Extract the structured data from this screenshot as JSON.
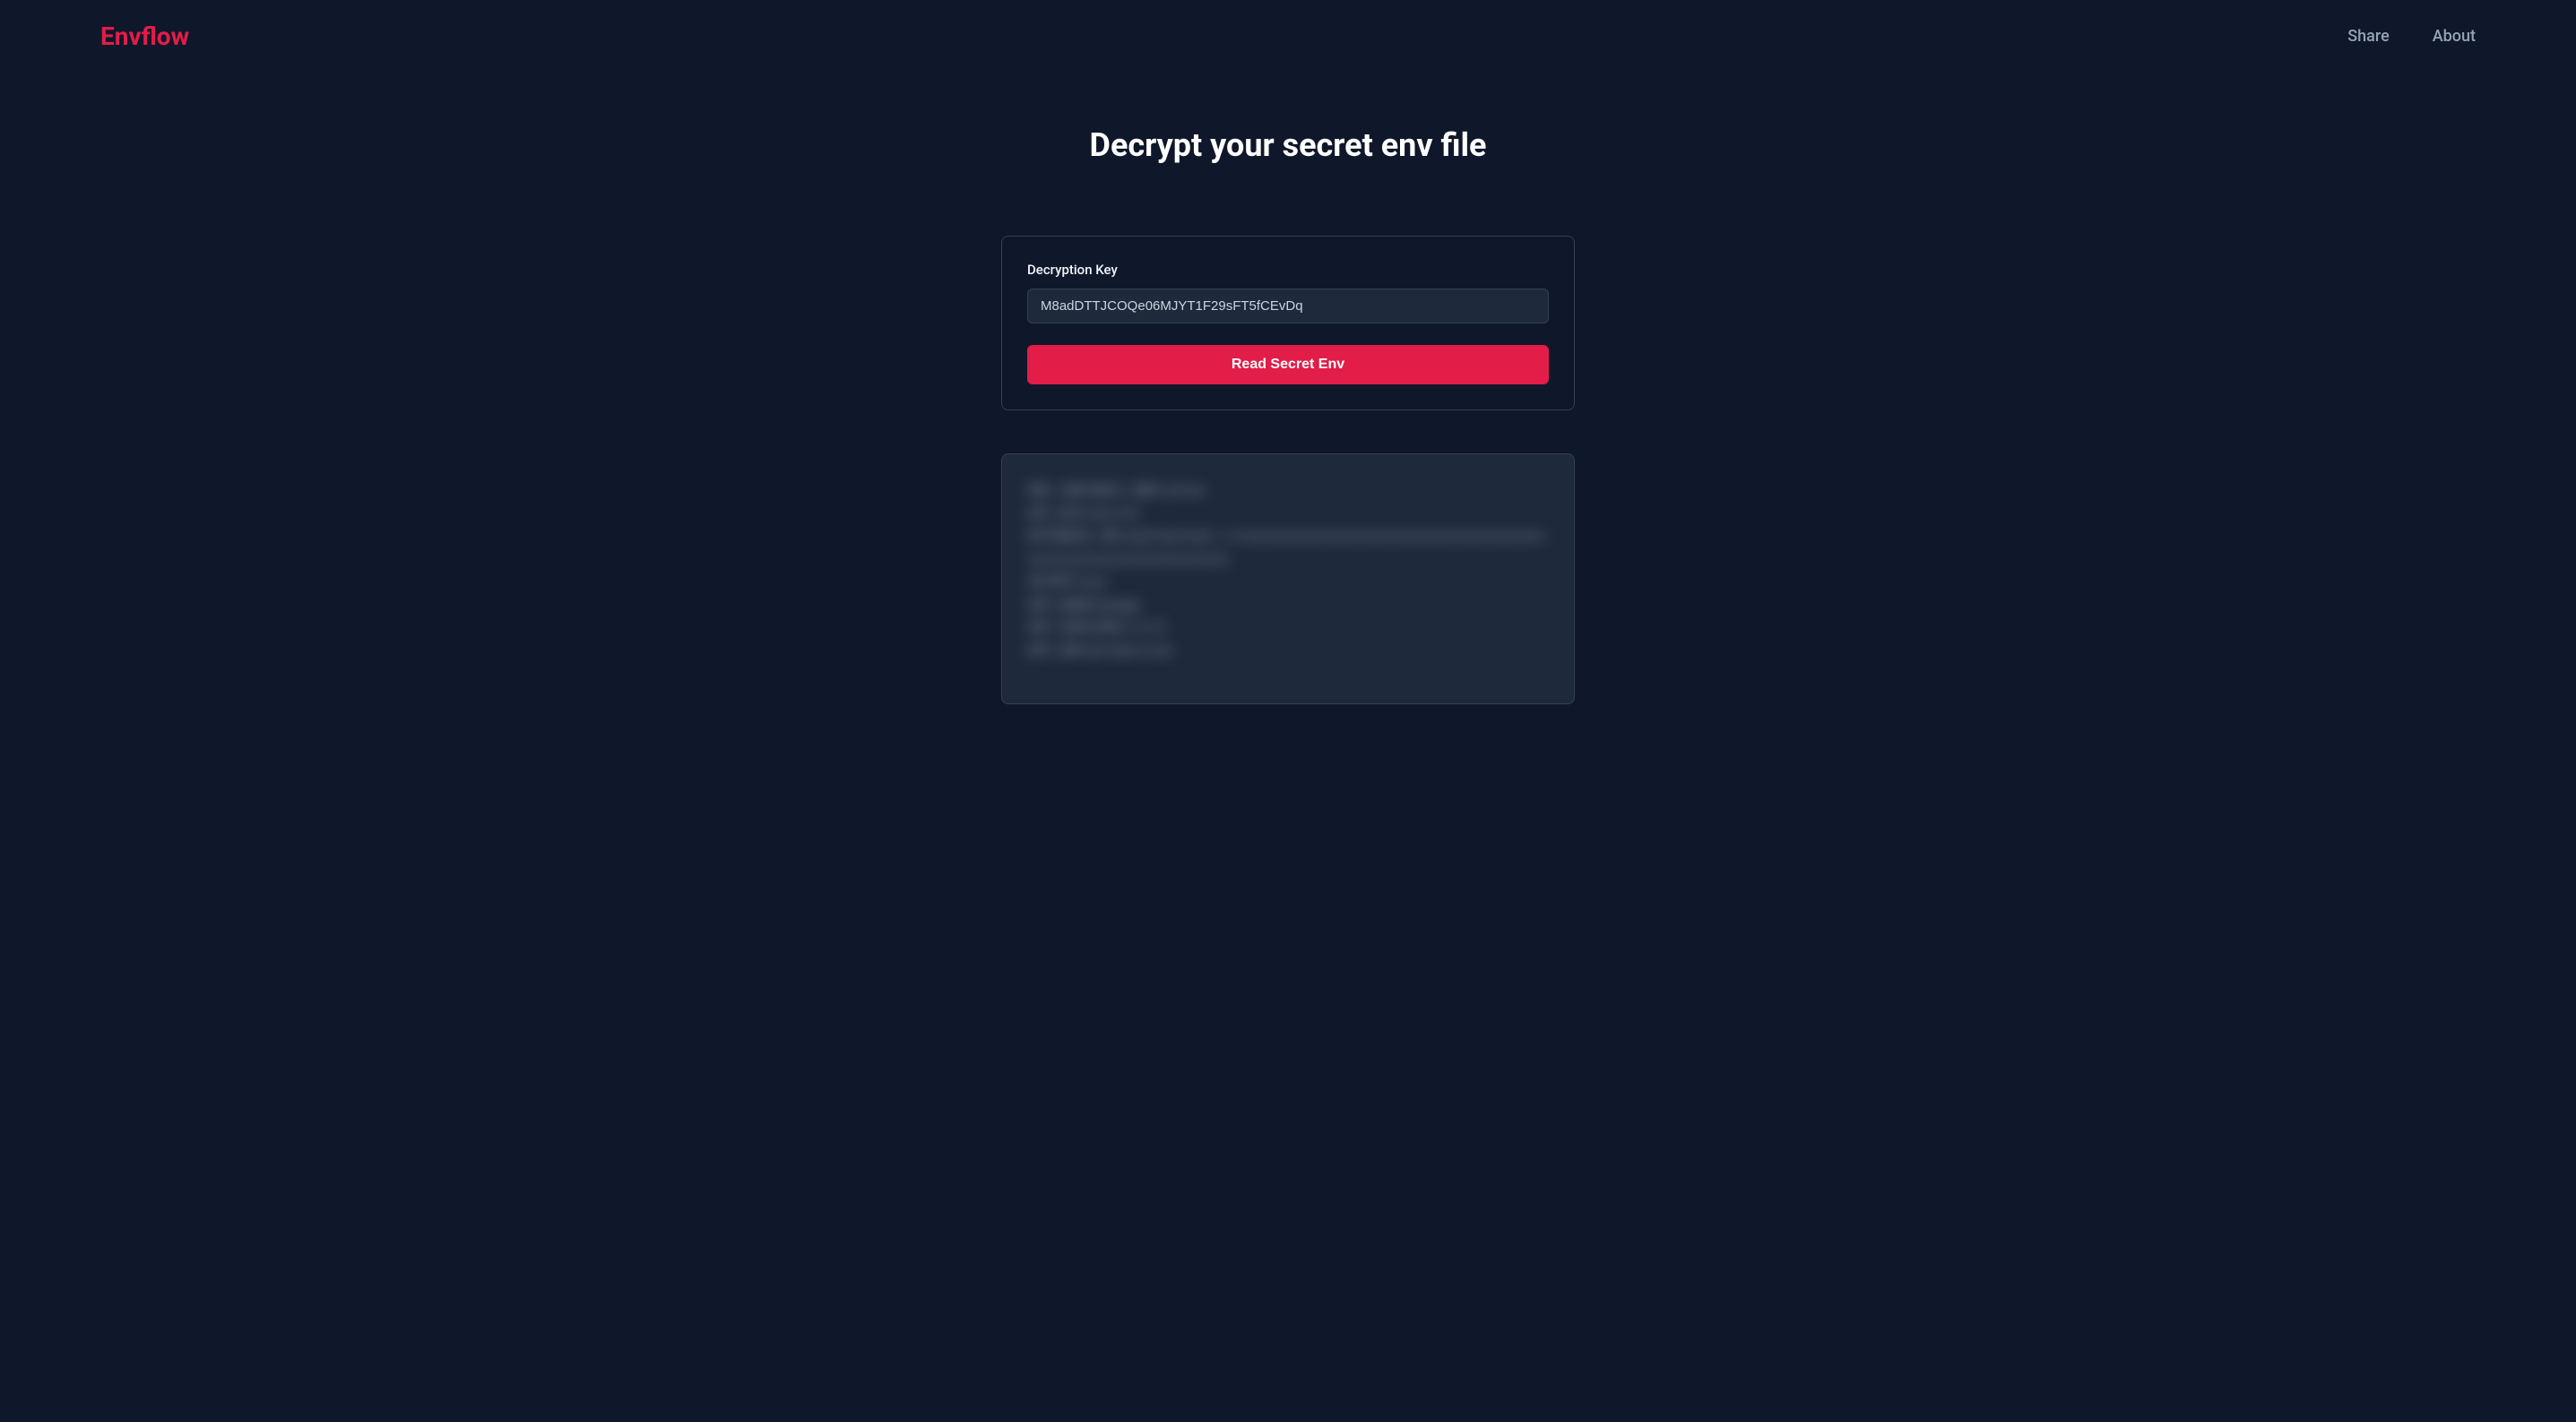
{
  "header": {
    "logo": "Envflow",
    "nav": {
      "share": "Share",
      "about": "About"
    }
  },
  "main": {
    "title": "Decrypt your secret env file",
    "form": {
      "keyLabel": "Decryption Key",
      "keyValue": "M8adDTTJCOQe06MJYT1F29sFT5fCEvDq",
      "submitLabel": "Read Secret Env"
    },
    "result": {
      "blurredPlaceholder": "ENV_VARIABLE_ONE=value\nAPI_KEY=secret\nDATABASE_URL=postgresql://xxxxxxxxxxxxxxxxxxxxxxxxxxxxxxxxxxxxxxxxxxxxxxxxxxxxxxxxxxxxxxx\nSECRET=xyz\nAPP_NAME=myapp\nAPP_VERSION=1.0.0\nAPP_ENV=production"
    }
  }
}
